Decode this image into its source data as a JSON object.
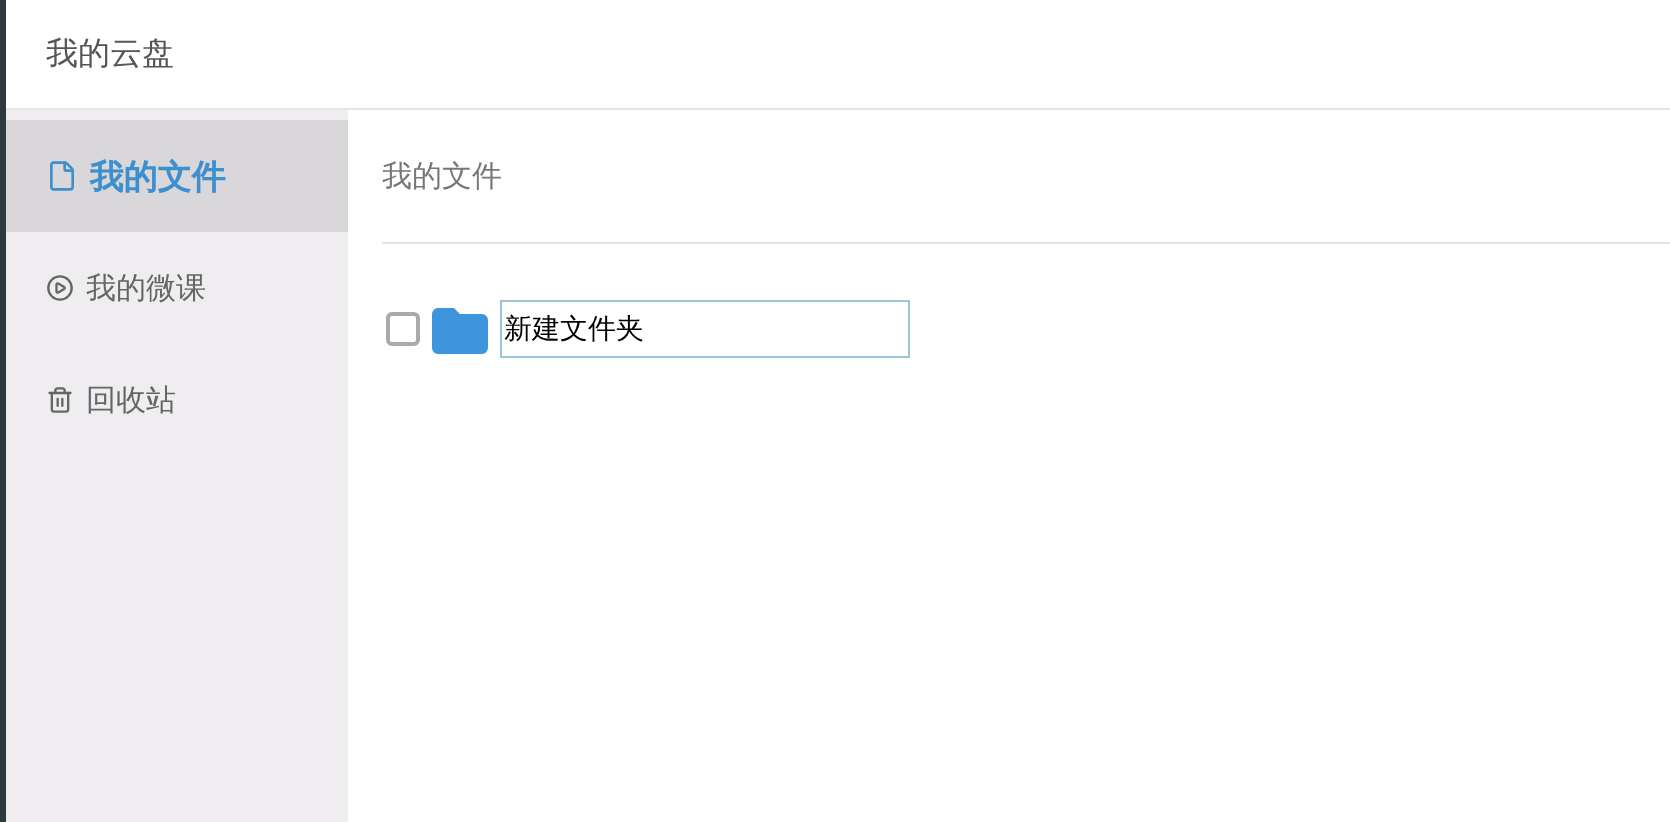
{
  "window": {
    "title": "我的云盘"
  },
  "sidebar": {
    "items": [
      {
        "kind": "file",
        "label": "我的文件",
        "selected": true
      },
      {
        "kind": "play",
        "label": "我的微课",
        "selected": false
      },
      {
        "kind": "trash",
        "label": "回收站",
        "selected": false
      }
    ]
  },
  "main": {
    "heading": "我的文件",
    "items": [
      {
        "checked": false,
        "value": "新建文件夹"
      }
    ]
  }
}
